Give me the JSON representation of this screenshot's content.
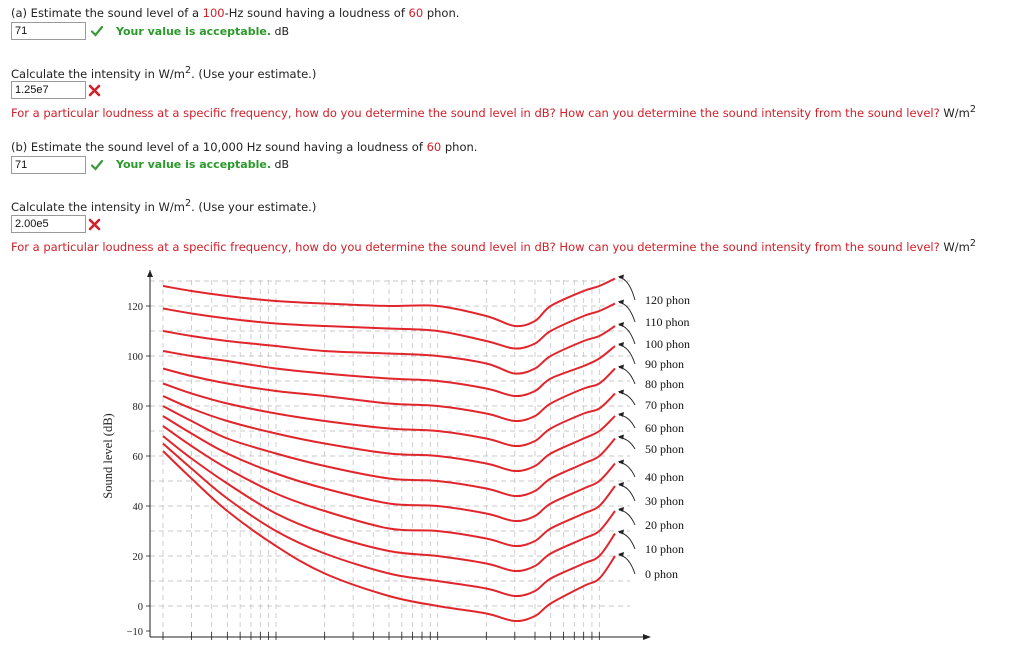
{
  "part_a": {
    "q1": {
      "prefix": "(a) Estimate the sound level of a ",
      "freq": "100",
      "mid": "-Hz sound having a loudness of ",
      "phon": "60",
      "suffix": " phon."
    },
    "answer1": "71",
    "feedback1": "Your value is acceptable.",
    "unit1": "dB",
    "q2": {
      "prefix": "Calculate the intensity in W/m",
      "sup": "2",
      "suffix": ". (Use your estimate.)"
    },
    "answer2": "1.25e7",
    "hint": "For a particular loudness at a specific frequency, how do you determine the sound level in dB? How can you determine the sound intensity from the sound level?",
    "hint_unit": "W/m",
    "hint_sup": "2"
  },
  "part_b": {
    "q1": {
      "prefix": "(b) Estimate the sound level of a 10,000 Hz sound having a loudness of ",
      "phon": "60",
      "suffix": " phon."
    },
    "answer1": "71",
    "feedback1": "Your value is acceptable.",
    "unit1": "dB",
    "q2": {
      "prefix": "Calculate the intensity in W/m",
      "sup": "2",
      "suffix": ". (Use your estimate.)"
    },
    "answer2": "2.00e5",
    "hint": "For a particular loudness at a specific frequency, how do you determine the sound level in dB? How can you determine the sound intensity from the sound level?",
    "hint_unit": "W/m",
    "hint_sup": "2"
  },
  "icons": {
    "correct": "check-icon",
    "incorrect": "x-icon"
  },
  "colors": {
    "accent_red": "#d0202a",
    "correct_green": "#2a9a2a",
    "curve": "#e0262c"
  },
  "chart_data": {
    "type": "line",
    "title": "",
    "xlabel": "",
    "ylabel": "Sound level (dB)",
    "x_scale": "log",
    "ylim": [
      -10,
      130
    ],
    "yticks": [
      "120",
      "100",
      "80",
      "60",
      "40",
      "20",
      "0",
      "−10"
    ],
    "ytick_values": [
      120,
      100,
      80,
      60,
      40,
      20,
      0,
      -10
    ],
    "x": [
      20,
      30,
      50,
      100,
      200,
      500,
      1000,
      2000,
      3000,
      4000,
      5000,
      8000,
      10000,
      12500
    ],
    "series": [
      {
        "name": "120 phon",
        "values": [
          128,
          126,
          124,
          122,
          121,
          120,
          120,
          116,
          112,
          114,
          120,
          126,
          128,
          131
        ]
      },
      {
        "name": "110 phon",
        "values": [
          119,
          117,
          115,
          113,
          112,
          111,
          110,
          106,
          103,
          105,
          110,
          116,
          118,
          121
        ]
      },
      {
        "name": "100 phon",
        "values": [
          110,
          108,
          106,
          104,
          102,
          101,
          100,
          97,
          93,
          95,
          100,
          106,
          108,
          112
        ]
      },
      {
        "name": "90 phon",
        "values": [
          102,
          100,
          98,
          95,
          93,
          91,
          90,
          87,
          84,
          86,
          91,
          96,
          99,
          104
        ]
      },
      {
        "name": "80 phon",
        "values": [
          95,
          92,
          89,
          86,
          84,
          81,
          80,
          77,
          74,
          76,
          81,
          87,
          89,
          95
        ]
      },
      {
        "name": "70 phon",
        "values": [
          89,
          85,
          81,
          77,
          74,
          71,
          70,
          67,
          64,
          66,
          71,
          77,
          79,
          85
        ]
      },
      {
        "name": "60 phon",
        "values": [
          84,
          79,
          74,
          69,
          65,
          61,
          60,
          57,
          54,
          56,
          61,
          67,
          70,
          76
        ]
      },
      {
        "name": "50 phon",
        "values": [
          80,
          74,
          67,
          61,
          56,
          51,
          50,
          47,
          44,
          46,
          51,
          57,
          60,
          67
        ]
      },
      {
        "name": "40 phon",
        "values": [
          76,
          69,
          61,
          53,
          47,
          41,
          40,
          37,
          34,
          36,
          41,
          47,
          50,
          57
        ]
      },
      {
        "name": "30 phon",
        "values": [
          72,
          64,
          55,
          45,
          38,
          31,
          30,
          27,
          24,
          26,
          31,
          37,
          40,
          48
        ]
      },
      {
        "name": "20 phon",
        "values": [
          68,
          59,
          49,
          37,
          29,
          22,
          20,
          17,
          14,
          16,
          21,
          27,
          30,
          38
        ]
      },
      {
        "name": "10 phon",
        "values": [
          65,
          55,
          43,
          30,
          21,
          13,
          10,
          7,
          4,
          6,
          11,
          17,
          20,
          29
        ]
      },
      {
        "name": "0 phon",
        "values": [
          62,
          51,
          38,
          24,
          13,
          4,
          0,
          -3,
          -6,
          -4,
          1,
          8,
          11,
          20
        ]
      }
    ],
    "grid": true,
    "legend": "labels at right end of each curve"
  }
}
